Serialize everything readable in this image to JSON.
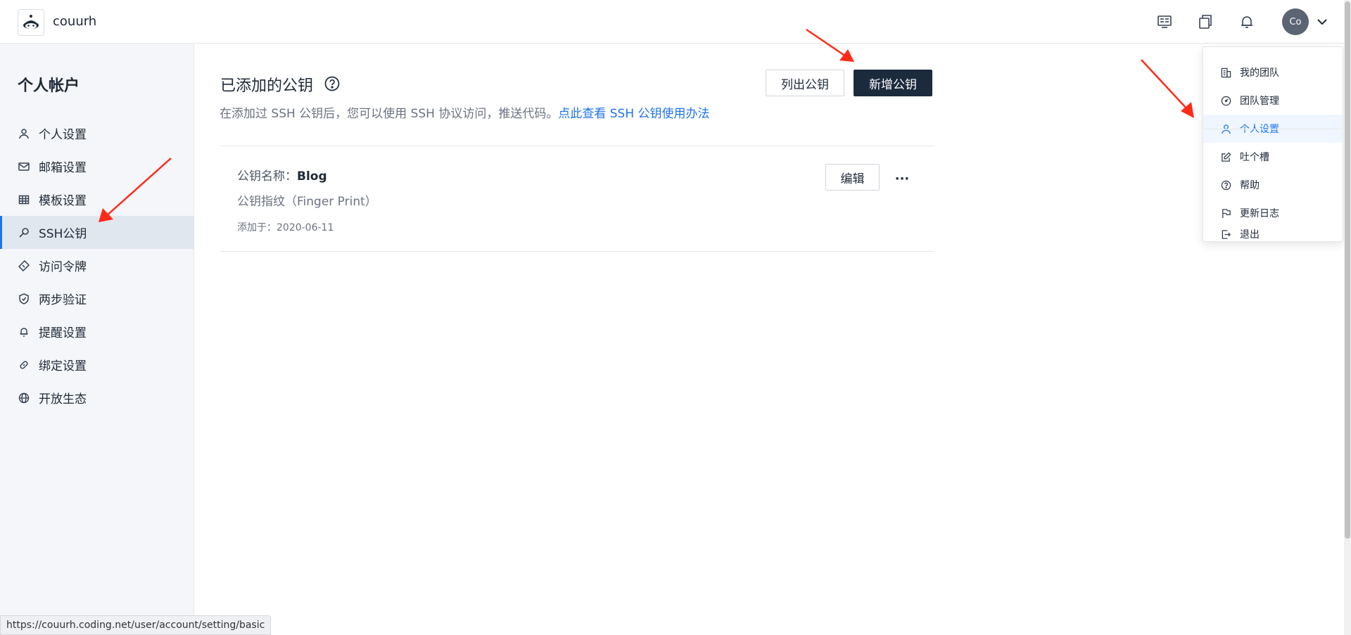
{
  "header": {
    "team_name": "couurh",
    "avatar_text": "Co",
    "icons": [
      "project-board-icon",
      "copy-window-icon",
      "bell-icon",
      "chevron-down-icon"
    ]
  },
  "sidebar": {
    "title": "个人帐户",
    "items": [
      {
        "label": "个人设置",
        "icon": "user-icon"
      },
      {
        "label": "邮箱设置",
        "icon": "mail-icon"
      },
      {
        "label": "模板设置",
        "icon": "grid-icon"
      },
      {
        "label": "SSH公钥",
        "icon": "key-icon",
        "active": true
      },
      {
        "label": "访问令牌",
        "icon": "ticket-icon"
      },
      {
        "label": "两步验证",
        "icon": "shield-icon"
      },
      {
        "label": "提醒设置",
        "icon": "bell-icon"
      },
      {
        "label": "绑定设置",
        "icon": "link-icon"
      },
      {
        "label": "开放生态",
        "icon": "globe-icon"
      }
    ]
  },
  "main": {
    "title": "已添加的公钥",
    "description_prefix": "在添加过 SSH 公钥后，您可以使用 SSH 协议访问，推送代码。",
    "description_link": "点此查看 SSH 公钥使用办法",
    "list_button": "列出公钥",
    "add_button": "新增公钥",
    "key": {
      "name_label": "公钥名称：",
      "name_value": "Blog",
      "fingerprint": "公钥指纹（Finger Print）",
      "added": "添加于：2020-06-11",
      "edit_button": "编辑",
      "more": "···"
    }
  },
  "dropdown": {
    "items": [
      {
        "label": "我的团队",
        "icon": "building-icon"
      },
      {
        "label": "团队管理",
        "icon": "dashboard-icon"
      },
      {
        "label": "个人设置",
        "icon": "user-icon",
        "active": true
      },
      {
        "label": "吐个槽",
        "icon": "edit-icon"
      },
      {
        "label": "帮助",
        "icon": "help-icon"
      },
      {
        "label": "更新日志",
        "icon": "flag-icon"
      },
      {
        "label": "退出",
        "icon": "logout-icon"
      }
    ]
  },
  "status_bar": {
    "url": "https://couurh.coding.net/user/account/setting/basic"
  },
  "colors": {
    "accent": "#1e73e8",
    "primary_button": "#1c2a3d",
    "sidebar_bg": "#f4f6f9",
    "annotation_arrow": "#ff2a1a"
  }
}
